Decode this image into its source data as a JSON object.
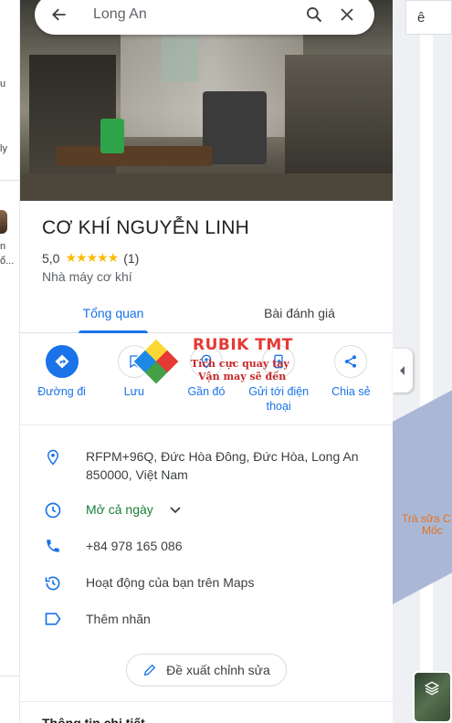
{
  "search": {
    "query": "Long An"
  },
  "place": {
    "name": "CƠ KHÍ NGUYỄN LINH",
    "rating": "5,0",
    "stars": "★★★★★",
    "review_count": "(1)",
    "category": "Nhà máy cơ khí"
  },
  "tabs": [
    {
      "label": "Tổng quan",
      "active": true
    },
    {
      "label": "Bài đánh giá",
      "active": false
    }
  ],
  "actions": [
    {
      "label": "Đường đi",
      "icon": "directions-icon"
    },
    {
      "label": "Lưu",
      "icon": "bookmark-icon"
    },
    {
      "label": "Gần đó",
      "icon": "nearby-icon"
    },
    {
      "label": "Gửi tới điện thoại",
      "icon": "send-to-phone-icon"
    },
    {
      "label": "Chia sẻ",
      "icon": "share-icon"
    }
  ],
  "info": {
    "address": "RFPM+96Q, Đức Hòa Đông, Đức Hòa, Long An 850000, Việt Nam",
    "hours": "Mở cả ngày",
    "phone": "+84 978 165 086",
    "activity": "Hoạt động của bạn trên Maps",
    "add_label": "Thêm nhãn"
  },
  "suggest_edit": "Đề xuất chỉnh sửa",
  "bottom_peek": "Thông tin chi tiết",
  "watermark": {
    "brand": "RUBIK TMT",
    "line1": "Tích cực quay tay",
    "line2": "Vận may sẽ đến"
  },
  "map": {
    "top_button": "ê",
    "place_label_line1": "Trà sữa C",
    "place_label_line2": "Mốc"
  },
  "left_strip": [
    "u",
    "ly",
    "n",
    "ổ..."
  ],
  "colors": {
    "accent": "#1a73e8",
    "open": "#188038",
    "star": "#fbbc04"
  }
}
